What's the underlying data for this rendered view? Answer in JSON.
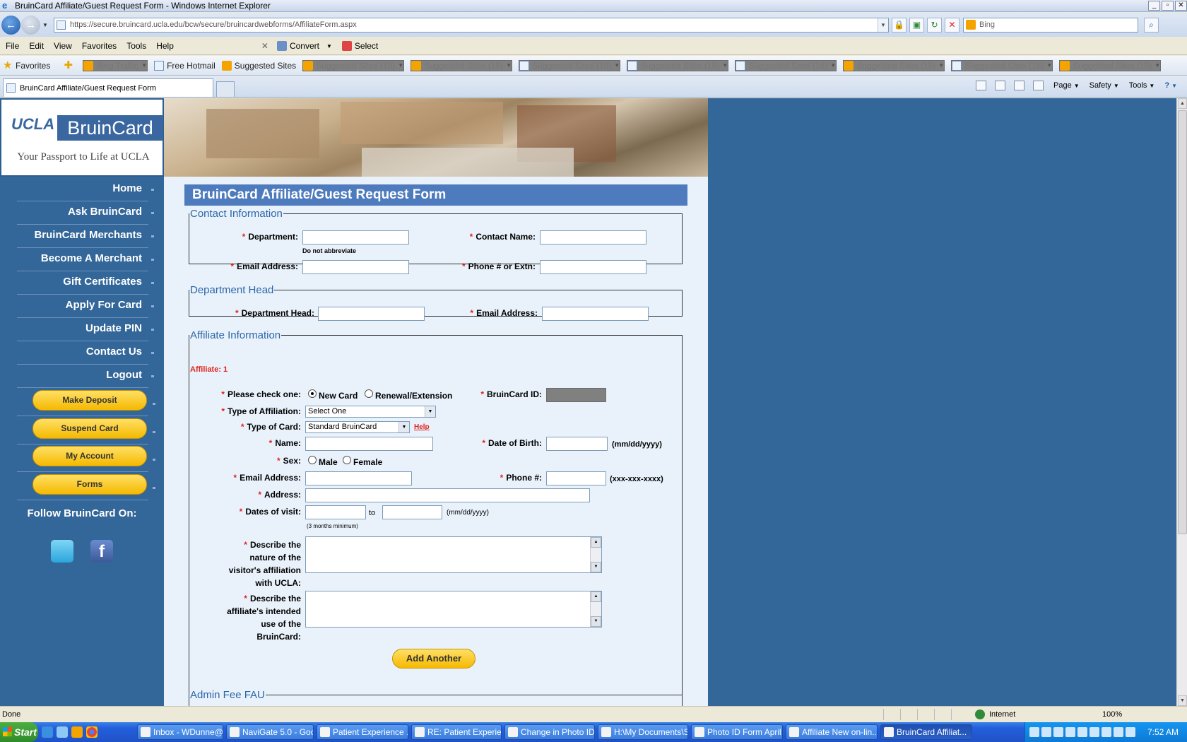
{
  "window": {
    "title": "BruinCard Affiliate/Guest Request Form - Windows Internet Explorer"
  },
  "address": {
    "url": "https://secure.bruincard.ucla.edu/bcw/secure/bruincardwebforms/AffiliateForm.aspx",
    "search_placeholder": "Bing"
  },
  "menu": {
    "items": [
      "File",
      "Edit",
      "View",
      "Favorites",
      "Tools",
      "Help"
    ],
    "convert": "Convert",
    "select": "Select"
  },
  "favorites": {
    "label": "Favorites",
    "items": [
      {
        "label": "Bing Traffic",
        "grey": true,
        "arrow": true
      },
      {
        "label": "Free Hotmail"
      },
      {
        "label": "Suggested Sites"
      },
      {
        "label": "Suggested Sites (15)",
        "grey": true,
        "arrow": true
      },
      {
        "label": "Suggested Sites (15)",
        "grey": true,
        "arrow": true
      },
      {
        "label": "Suggested Sites (15)",
        "grey": true,
        "arrow": true
      },
      {
        "label": "Suggested Sites (15)",
        "grey": true,
        "arrow": true
      },
      {
        "label": "Suggested Sites (15)",
        "grey": true,
        "arrow": true
      },
      {
        "label": "Suggested Sites (15)",
        "grey": true,
        "arrow": true
      },
      {
        "label": "Suggested Sites (15)",
        "grey": true,
        "arrow": true
      },
      {
        "label": "Suggested Sites (15)",
        "grey": true,
        "arrow": true
      }
    ]
  },
  "tab": {
    "title": "BruinCard Affiliate/Guest Request Form"
  },
  "commandbar": {
    "page": "Page",
    "safety": "Safety",
    "tools": "Tools"
  },
  "sidebar": {
    "logo_ucla": "UCLA",
    "logo_bruincard": "BruinCard",
    "tagline": "Your Passport to Life at UCLA",
    "nav": [
      "Home",
      "Ask BruinCard",
      "BruinCard Merchants",
      "Become A Merchant",
      "Gift Certificates",
      "Apply For Card",
      "Update PIN",
      "Contact Us",
      "Logout"
    ],
    "pills": [
      "Make Deposit",
      "Suspend Card",
      "My Account",
      "Forms"
    ],
    "follow": "Follow BruinCard On:"
  },
  "form": {
    "title": "BruinCard Affiliate/Guest Request Form",
    "contact": {
      "legend": "Contact Information",
      "department": "Department:",
      "department_hint": "Do not abbreviate",
      "contact_name": "Contact Name:",
      "email": "Email Address:",
      "phone": "Phone # or Extn:"
    },
    "dept_head": {
      "legend": "Department Head",
      "head": "Department Head:",
      "email": "Email Address:"
    },
    "affiliate": {
      "legend": "Affiliate Information",
      "counter": "Affiliate: 1",
      "check_one": "Please check one:",
      "new_card": "New Card",
      "renewal": "Renewal/Extension",
      "bruincard_id": "BruinCard ID:",
      "type_affiliation": "Type of Affiliation:",
      "type_affiliation_value": "Select One",
      "type_card": "Type of Card:",
      "type_card_value": "Standard BruinCard",
      "help": "Help",
      "name": "Name:",
      "dob": "Date of Birth:",
      "dob_format": "(mm/dd/yyyy)",
      "sex": "Sex:",
      "male": "Male",
      "female": "Female",
      "email": "Email Address:",
      "phone": "Phone #:",
      "phone_format": "(xxx-xxx-xxxx)",
      "address": "Address:",
      "dates": "Dates of visit:",
      "to": "to",
      "dates_format": "(mm/dd/yyyy)",
      "dates_min": "(3 months minimum)",
      "nature_l1": "Describe the",
      "nature_l2": "nature of the",
      "nature_l3": "visitor's affiliation",
      "nature_l4": "with UCLA:",
      "use_l1": "Describe the",
      "use_l2": "affiliate's intended",
      "use_l3": "use of the",
      "use_l4": "BruinCard:",
      "add_another": "Add Another"
    },
    "admin": {
      "legend": "Admin Fee FAU"
    }
  },
  "status": {
    "text": "Done",
    "zone": "Internet",
    "zoom": "100%"
  },
  "taskbar": {
    "start": "Start",
    "tasks": [
      "Inbox - WDunne@...",
      "NaviGate 5.0 - Goo...",
      "Patient Experience ...",
      "RE: Patient Experie...",
      "Change in Photo ID...",
      "H:\\My Documents\\S...",
      "Photo ID Form April...",
      "Affiliate New on-lin...",
      "BruinCard Affiliat..."
    ],
    "clock": "7:52 AM"
  },
  "colors": {
    "page_bg": "#336699",
    "form_bg": "#e9f2fb",
    "title_bar": "#4d7bbd",
    "pill": "#f5b900",
    "required": "#e0231d"
  }
}
